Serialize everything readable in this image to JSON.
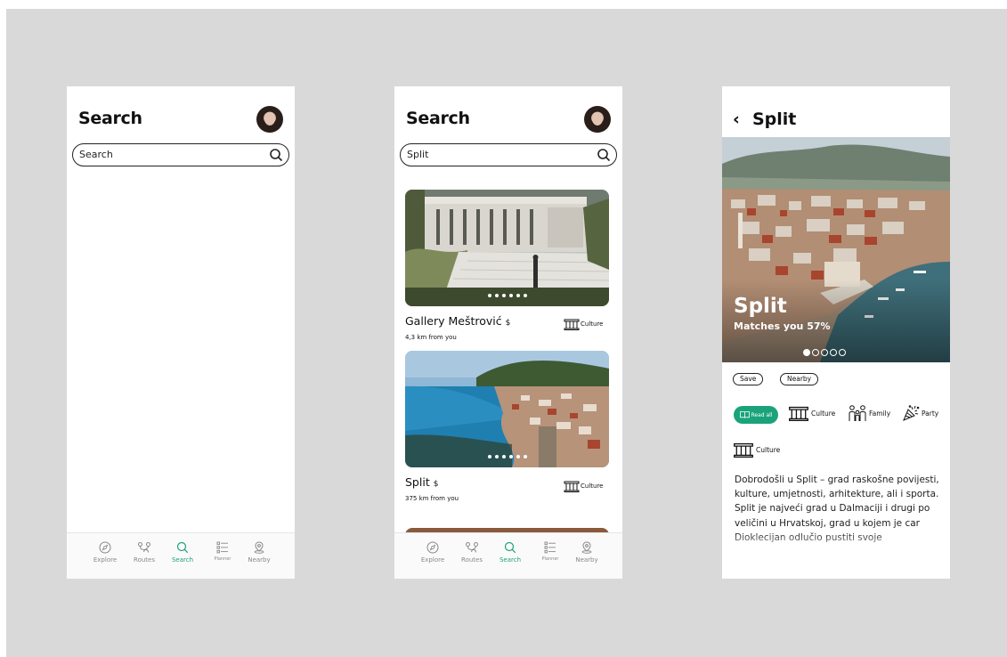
{
  "screens": [
    {
      "title": "Search",
      "search": {
        "value": "Search"
      },
      "tabs": [
        {
          "label": "Explore",
          "icon": "compass-icon"
        },
        {
          "label": "Routes",
          "icon": "routes-icon"
        },
        {
          "label": "Search",
          "icon": "search-icon",
          "active": true
        },
        {
          "label": "Planner",
          "icon": "list-icon"
        },
        {
          "label": "Nearby",
          "icon": "location-icon"
        }
      ]
    },
    {
      "title": "Search",
      "search": {
        "value": "Split"
      },
      "results": [
        {
          "name": "Gallery Meštrović",
          "cost": "$",
          "distance": "4,3 km from you",
          "category": "Culture",
          "category_icon": "column-icon"
        },
        {
          "name": "Split",
          "cost": "$",
          "distance": "375 km from you",
          "category": "Culture",
          "category_icon": "column-icon"
        }
      ],
      "tabs": [
        {
          "label": "Explore"
        },
        {
          "label": "Routes"
        },
        {
          "label": "Search",
          "active": true
        },
        {
          "label": "Planner"
        },
        {
          "label": "Nearby"
        }
      ]
    },
    {
      "title": "Split",
      "back_icon": "chevron-left-icon",
      "hero": {
        "name": "Split",
        "match": "Matches you 57%",
        "slide_count": 5,
        "active_slide": 1
      },
      "actions": {
        "save": "Save",
        "nearby": "Nearby"
      },
      "read_all": "Read all",
      "categories": [
        "Culture",
        "Family",
        "Party"
      ],
      "extra_category": "Culture",
      "description": "Dobrodošli u Split – grad raskošne povijesti, kulture, umjetnosti, arhitekture, ali i sporta. Split je najveći grad u Dalmaciji i drugi po veličini u Hrvatskoj, grad u kojem je car Dioklecijan odlučio pustiti svoje"
    }
  ],
  "colors": {
    "accent": "#1aa37a",
    "background": "#d9d9d9"
  }
}
